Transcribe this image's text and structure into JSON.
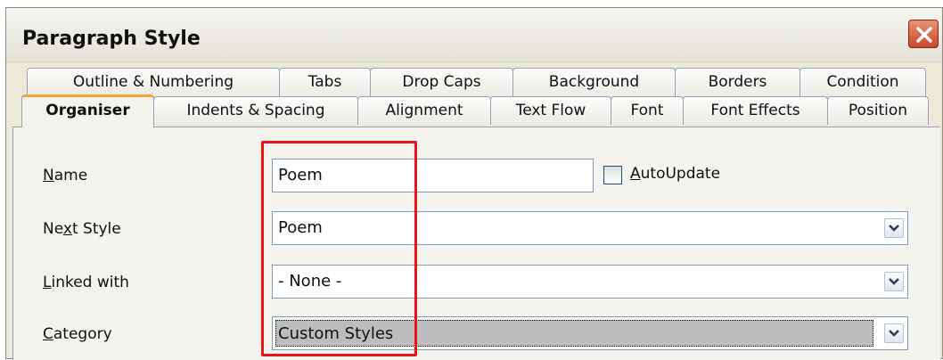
{
  "window": {
    "title": "Paragraph Style"
  },
  "tabs_row1": [
    "Outline & Numbering",
    "Tabs",
    "Drop Caps",
    "Background",
    "Borders",
    "Condition"
  ],
  "tabs_row2": [
    "Organiser",
    "Indents & Spacing",
    "Alignment",
    "Text Flow",
    "Font",
    "Font Effects",
    "Position"
  ],
  "active_tab": "Organiser",
  "form": {
    "name": {
      "label_pre": "",
      "label_accel": "N",
      "label_post": "ame",
      "value": "Poem"
    },
    "autoupdate": {
      "label_accel": "A",
      "label_post": "utoUpdate",
      "checked": false
    },
    "next_style": {
      "label_pre": "Ne",
      "label_accel": "x",
      "label_post": "t Style",
      "value": "Poem"
    },
    "linked_with": {
      "label_pre": "",
      "label_accel": "L",
      "label_post": "inked with",
      "value": "- None -"
    },
    "category": {
      "label_pre": "",
      "label_accel": "C",
      "label_post": "ategory",
      "value": "Custom Styles"
    }
  },
  "colors": {
    "highlight_box": "#e8141a",
    "active_tab_accent": "#f0a43a",
    "dialog_bg": "#ece9d8"
  },
  "icons": {
    "close": "close-icon",
    "dropdown": "chevron-down-icon"
  }
}
